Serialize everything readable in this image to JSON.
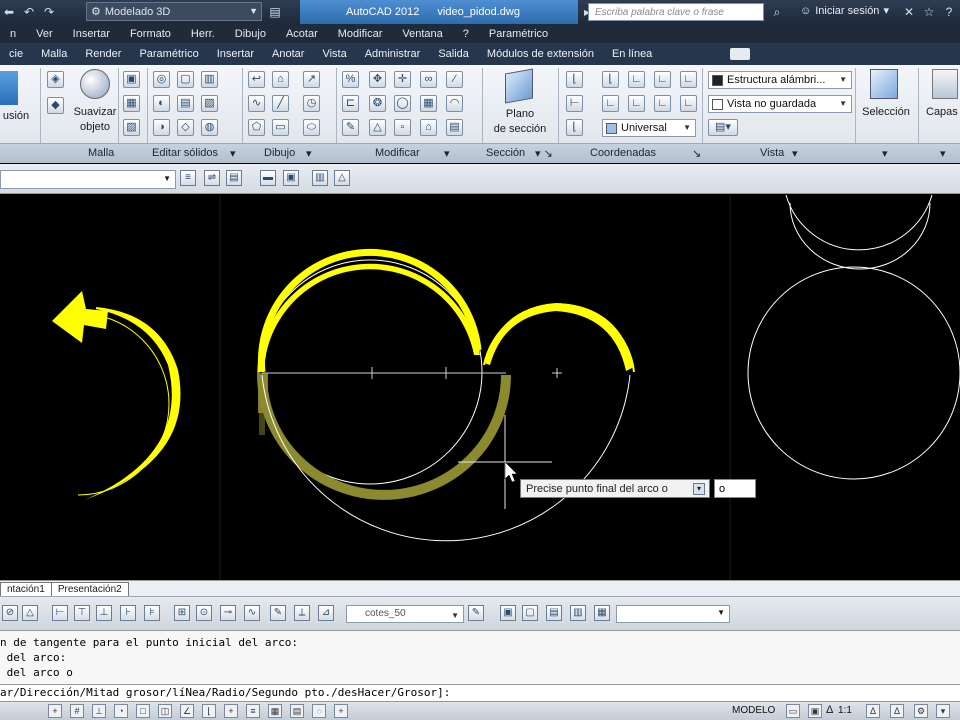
{
  "titlebar": {
    "workspace": "Modelado 3D",
    "app": "AutoCAD 2012",
    "file": "video_pidod.dwg",
    "search_placeholder": "Escriba palabra clave o frase",
    "signin": "Iniciar sesión"
  },
  "menubar": [
    "cie",
    "Malla",
    "Render",
    "Paramétrico",
    "Insertar",
    "Anotar",
    "Vista",
    "Administrar",
    "Salida",
    "Módulos de extensión",
    "En línea"
  ],
  "menubar_top": [
    "n",
    "Ver",
    "Insertar",
    "Formato",
    "Herr.",
    "Dibujo",
    "Acotar",
    "Modificar",
    "Ventana",
    "?",
    "Paramétrico"
  ],
  "ribbon": {
    "big_buttons": {
      "extrusion": "usión",
      "suavizar_line1": "Suavizar",
      "suavizar_line2": "objeto",
      "plano_line1": "Plano",
      "plano_line2": "de sección",
      "seleccion": "Selección",
      "capas": "Capas"
    },
    "combos": {
      "visual_style": "Estructura alámbri...",
      "view": "Vista no guardada",
      "ucs": "Universal"
    },
    "panels": [
      "Malla",
      "Editar sólidos",
      "Dibujo",
      "Modificar",
      "Sección",
      "Coordenadas",
      "Vista"
    ]
  },
  "canvas": {
    "tooltip": "Precise punto final del arco o",
    "dynamic_input": "o"
  },
  "layout_tabs": [
    "ntación1",
    "Presentación2"
  ],
  "bottom_toolbar": {
    "text_style": "cotes_50"
  },
  "command": {
    "history": [
      "n de tangente para el punto inicial del arco:",
      " del arco:",
      " del arco o"
    ],
    "prompt": "ar/Dirección/Mitad grosor/líNea/Radio/Segundo pto./desHacer/Grosor]:"
  },
  "status": {
    "model": "MODELO",
    "scale": "1:1"
  },
  "colors": {
    "accent_title": "#2e6cb0",
    "polyline_yellow": "#ffff00",
    "polyline_dim": "#8c8a2e",
    "geometry_white": "#ffffff"
  }
}
